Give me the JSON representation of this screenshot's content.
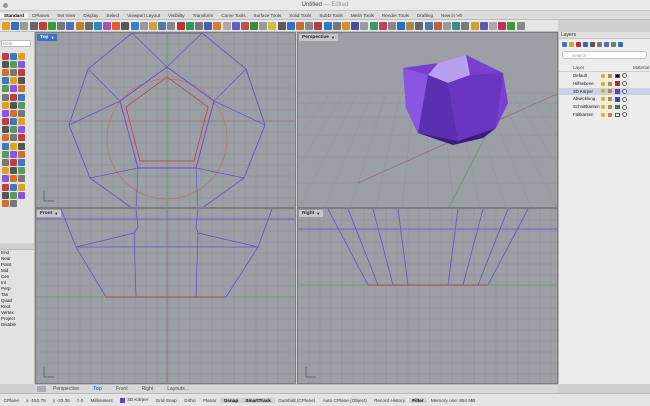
{
  "window": {
    "title": "Untitled",
    "title_suffix": "— Edited"
  },
  "tabs": [
    "Standard",
    "CPlanes",
    "Set View",
    "Display",
    "Select",
    "Viewport Layout",
    "Visibility",
    "Transform",
    "Curve Tools",
    "Surface Tools",
    "Solid Tools",
    "SubD Tools",
    "Mesh Tools",
    "Render Tools",
    "Drafting",
    "New in V6"
  ],
  "left_panel": {
    "search_placeholder": "Help",
    "osnaps": [
      "End",
      "Near",
      "Point",
      "Mid",
      "Cen",
      "Int",
      "Perp",
      "Tan",
      "Quad",
      "Knot",
      "Vertex",
      "Project",
      "Disable"
    ]
  },
  "viewports": [
    {
      "label": "Top",
      "active": true
    },
    {
      "label": "Perspective",
      "active": false
    },
    {
      "label": "Front",
      "active": false
    },
    {
      "label": "Right",
      "active": false
    }
  ],
  "layers": {
    "header": "Layers",
    "search_placeholder": "Search",
    "column_layer": "Layer",
    "column_material": "Material",
    "rows": [
      {
        "name": "Default",
        "color": "#000000",
        "current": false
      },
      {
        "name": "Hilfsebene",
        "color": "#d62020",
        "current": false
      },
      {
        "name": "3D Körper",
        "color": "#7a3fd0",
        "current": true
      },
      {
        "name": "Abwicklung",
        "color": "#2040d0",
        "current": false
      },
      {
        "name": "Schnittkanten",
        "color": "#20a030",
        "current": false
      },
      {
        "name": "Faltkanten",
        "color": "#ffffff",
        "current": false
      }
    ]
  },
  "viewport_tabs": [
    "Perspective",
    "Top",
    "Front",
    "Right",
    "Layouts..."
  ],
  "active_viewport_tab": "Top",
  "status": {
    "x": "x -152.79",
    "y": "y -33.36",
    "z": "z 0",
    "units": "Millimeters",
    "layer": "3D Körper",
    "toggles": [
      "Grid Snap",
      "Ortho",
      "Planar",
      "Osnap",
      "SmartTrack",
      "Gumball (CPlane)",
      "Auto CPlane (Object)",
      "Record History",
      "Filter"
    ],
    "memory": "Memory use: 854 MB"
  },
  "colors": {
    "accent": "#3d6fc4",
    "object": "#7a3fd0",
    "curve": "#7050c8",
    "redcurve": "#c03040"
  }
}
